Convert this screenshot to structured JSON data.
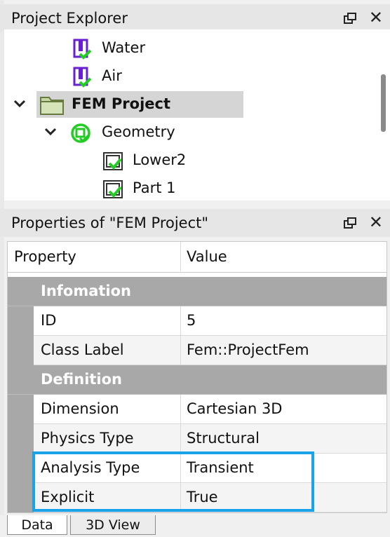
{
  "project_explorer": {
    "title": "Project Explorer",
    "items": [
      {
        "label": "Water",
        "icon": "material-icon"
      },
      {
        "label": "Air",
        "icon": "material-icon"
      },
      {
        "label": "FEM Project",
        "icon": "folder-icon",
        "expanded": true,
        "selected": true
      },
      {
        "label": "Geometry",
        "icon": "geometry-icon",
        "expanded": true
      },
      {
        "label": "Lower2",
        "icon": "part-icon"
      },
      {
        "label": "Part 1",
        "icon": "part-icon"
      }
    ]
  },
  "properties": {
    "title": "Properties of \"FEM Project\"",
    "col_property": "Property",
    "col_value": "Value",
    "groups": [
      {
        "name": "Infomation",
        "rows": [
          {
            "key": "ID",
            "value": "5"
          },
          {
            "key": "Class Label",
            "value": "Fem::ProjectFem"
          }
        ]
      },
      {
        "name": "Definition",
        "rows": [
          {
            "key": "Dimension",
            "value": "Cartesian 3D"
          },
          {
            "key": "Physics Type",
            "value": "Structural"
          },
          {
            "key": "Analysis Type",
            "value": "Transient"
          },
          {
            "key": "Explicit",
            "value": "True"
          }
        ]
      }
    ]
  },
  "tabs": [
    {
      "label": "Data",
      "active": true
    },
    {
      "label": "3D View",
      "active": false
    }
  ],
  "colors": {
    "highlight": "#1aa3e8",
    "group_bg": "#a8a8a8",
    "check_green": "#22cc22",
    "material_purple": "#6a1fd1"
  }
}
